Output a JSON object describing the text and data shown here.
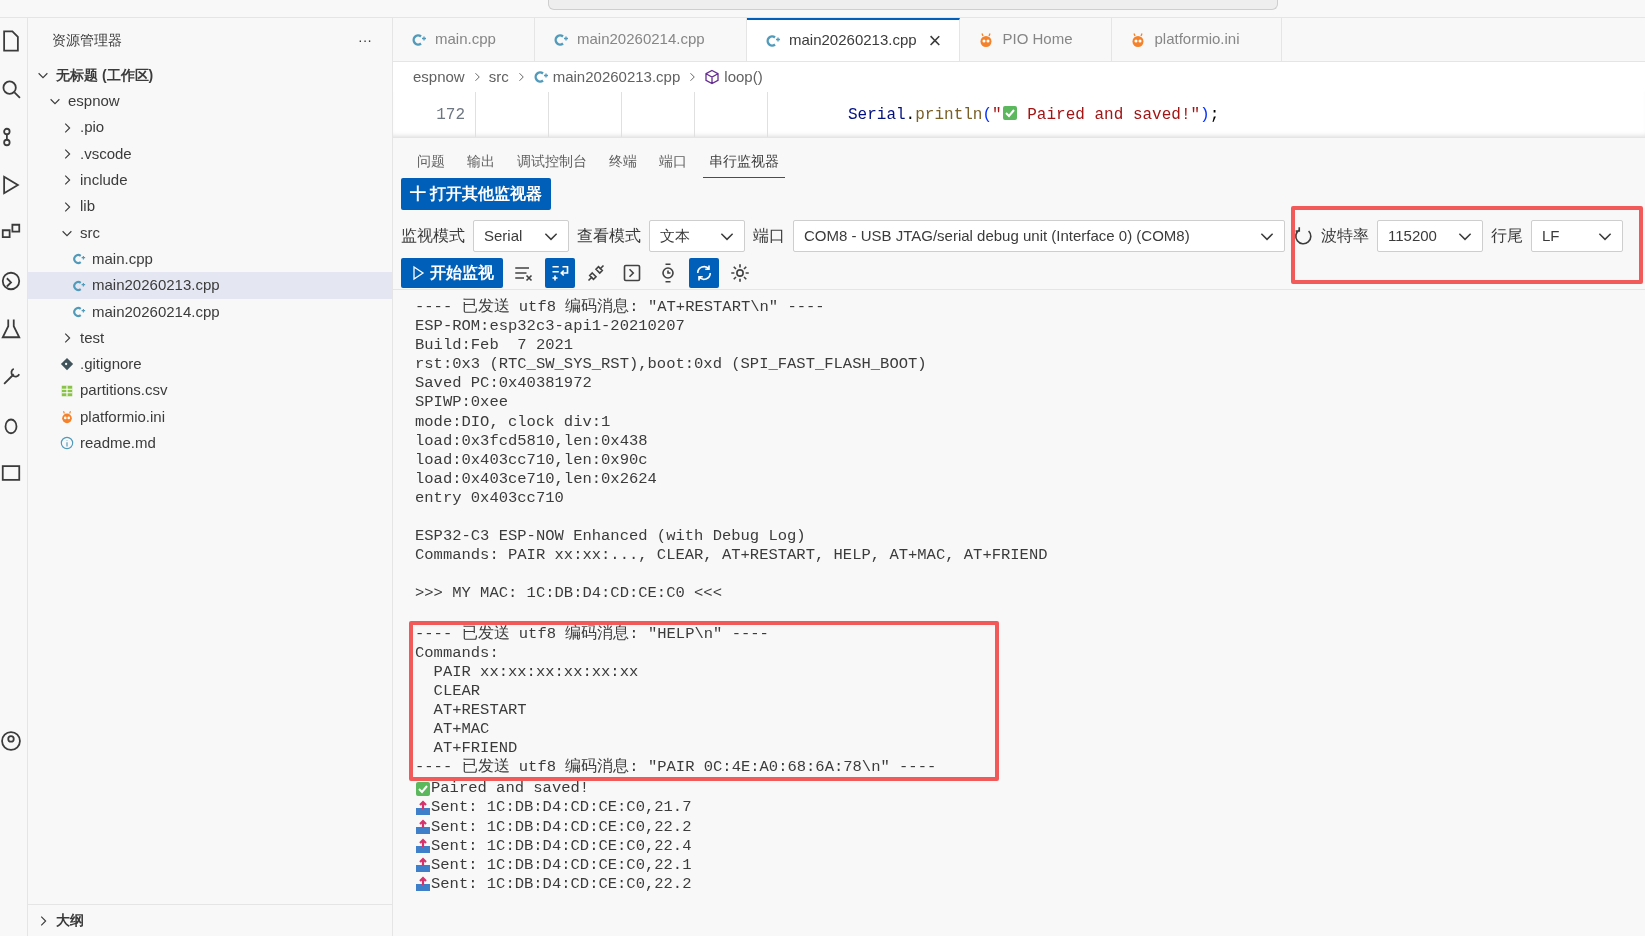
{
  "sidebar": {
    "title": "资源管理器",
    "more": "···",
    "tree": [
      {
        "label": "无标题 (工作区)",
        "kind": "workspace",
        "expanded": true,
        "selected": false,
        "children": [
          {
            "label": "espnow",
            "kind": "folder",
            "expanded": true,
            "selected": false,
            "children": [
              {
                "label": ".pio",
                "kind": "folder",
                "expanded": false,
                "selected": false
              },
              {
                "label": ".vscode",
                "kind": "folder",
                "expanded": false,
                "selected": false
              },
              {
                "label": "include",
                "kind": "folder",
                "expanded": false,
                "selected": false
              },
              {
                "label": "lib",
                "kind": "folder",
                "expanded": false,
                "selected": false
              },
              {
                "label": "src",
                "kind": "folder",
                "expanded": true,
                "selected": false,
                "children": [
                  {
                    "label": "main.cpp",
                    "kind": "cpp",
                    "selected": false
                  },
                  {
                    "label": "main20260213.cpp",
                    "kind": "cpp",
                    "selected": true
                  },
                  {
                    "label": "main20260214.cpp",
                    "kind": "cpp",
                    "selected": false
                  }
                ]
              },
              {
                "label": "test",
                "kind": "folder",
                "expanded": false,
                "selected": false
              },
              {
                "label": ".gitignore",
                "kind": "git",
                "selected": false
              },
              {
                "label": "partitions.csv",
                "kind": "csv",
                "selected": false
              },
              {
                "label": "platformio.ini",
                "kind": "pio",
                "selected": false
              },
              {
                "label": "readme.md",
                "kind": "info",
                "selected": false
              }
            ]
          }
        ]
      }
    ],
    "outline": {
      "label": "大纲",
      "expanded": false
    }
  },
  "tabs": [
    {
      "label": "main.cpp",
      "kind": "cpp",
      "selected": false
    },
    {
      "label": "main20260214.cpp",
      "kind": "cpp",
      "selected": false
    },
    {
      "label": "main20260213.cpp",
      "kind": "cpp",
      "selected": true,
      "close": "×"
    },
    {
      "label": "PIO Home",
      "kind": "pio",
      "selected": false
    },
    {
      "label": "platformio.ini",
      "kind": "pio",
      "selected": false
    }
  ],
  "breadcrumb": [
    {
      "label": "espnow",
      "kind": "plain"
    },
    {
      "label": "src",
      "kind": "plain"
    },
    {
      "label": "main20260213.cpp",
      "kind": "cpp"
    },
    {
      "label": "loop()",
      "kind": "method"
    }
  ],
  "code": {
    "line_number": "172",
    "tokens": [
      {
        "text": "Serial",
        "kind": "ident"
      },
      {
        "text": ".",
        "kind": "punct"
      },
      {
        "text": "println",
        "kind": "func"
      },
      {
        "text": "(",
        "kind": "paren"
      },
      {
        "text": "\"",
        "kind": "string"
      },
      {
        "kind": "check"
      },
      {
        "text": " Paired and saved!\"",
        "kind": "string"
      },
      {
        "text": ")",
        "kind": "paren"
      },
      {
        "text": ";",
        "kind": "punct"
      }
    ]
  },
  "panel_tabs": [
    {
      "label": "问题",
      "selected": false
    },
    {
      "label": "输出",
      "selected": false
    },
    {
      "label": "调试控制台",
      "selected": false
    },
    {
      "label": "终端",
      "selected": false
    },
    {
      "label": "端口",
      "selected": false
    },
    {
      "label": "串行监视器",
      "selected": true
    }
  ],
  "open_monitor_button": "十 打开其他监视器",
  "settings": [
    {
      "label": "监视模式",
      "value": "Serial",
      "kind": "select"
    },
    {
      "label": "查看模式",
      "value": "文本",
      "kind": "select"
    },
    {
      "label": "端口",
      "value": "COM8 - USB JTAG/serial debug unit (Interface 0) (COM8)",
      "kind": "port"
    }
  ],
  "highlighted_settings": {
    "highlighted": true,
    "items": [
      {
        "label": "波特率",
        "value": "115200"
      },
      {
        "label": "行尾",
        "value": "LF"
      }
    ]
  },
  "start_button": "开始监视",
  "tools": [
    {
      "kind": "clear",
      "selected": false
    },
    {
      "kind": "wrap",
      "selected": true
    },
    {
      "kind": "connect",
      "selected": false
    },
    {
      "kind": "terminal",
      "selected": false
    },
    {
      "kind": "timestamp",
      "selected": false
    },
    {
      "kind": "autoscroll",
      "selected": true
    },
    {
      "kind": "settings",
      "selected": false
    }
  ],
  "log_top": [
    {
      "kind": "plain",
      "text": "---- 已发送 utf8 编码消息: \"AT+RESTART\\n\" ----"
    },
    {
      "kind": "plain",
      "text": "ESP-ROM:esp32c3-api1-20210207"
    },
    {
      "kind": "plain",
      "text": "Build:Feb  7 2021"
    },
    {
      "kind": "plain",
      "text": "rst:0x3 (RTC_SW_SYS_RST),boot:0xd (SPI_FAST_FLASH_BOOT)"
    },
    {
      "kind": "plain",
      "text": "Saved PC:0x40381972"
    },
    {
      "kind": "plain",
      "text": "SPIWP:0xee"
    },
    {
      "kind": "plain",
      "text": "mode:DIO, clock div:1"
    },
    {
      "kind": "plain",
      "text": "load:0x3fcd5810,len:0x438"
    },
    {
      "kind": "plain",
      "text": "load:0x403cc710,len:0x90c"
    },
    {
      "kind": "plain",
      "text": "load:0x403ce710,len:0x2624"
    },
    {
      "kind": "plain",
      "text": "entry 0x403cc710"
    },
    {
      "kind": "blank"
    },
    {
      "kind": "plain",
      "text": "ESP32-C3 ESP-NOW Enhanced (with Debug Log)"
    },
    {
      "kind": "plain",
      "text": "Commands: PAIR xx:xx:..., CLEAR, AT+RESTART, HELP, AT+MAC, AT+FRIEND"
    },
    {
      "kind": "blank"
    },
    {
      "kind": "plain",
      "text": ">>> MY MAC: 1C:DB:D4:CD:CE:C0 <<<"
    },
    {
      "kind": "blank"
    }
  ],
  "log_highlight": {
    "highlighted": true,
    "lines": [
      {
        "kind": "plain",
        "text": "---- 已发送 utf8 编码消息: \"HELP\\n\" ----"
      },
      {
        "kind": "plain",
        "text": "Commands:"
      },
      {
        "kind": "plain",
        "text": "  PAIR xx:xx:xx:xx:xx:xx"
      },
      {
        "kind": "plain",
        "text": "  CLEAR"
      },
      {
        "kind": "plain",
        "text": "  AT+RESTART"
      },
      {
        "kind": "plain",
        "text": "  AT+MAC"
      },
      {
        "kind": "plain",
        "text": "  AT+FRIEND"
      },
      {
        "kind": "plain",
        "text": "---- 已发送 utf8 编码消息: \"PAIR 0C:4E:A0:68:6A:78\\n\" ----"
      }
    ]
  },
  "log_bottom": [
    {
      "kind": "check",
      "text": "Paired and saved!"
    },
    {
      "kind": "sent",
      "text": "Sent: 1C:DB:D4:CD:CE:C0,21.7"
    },
    {
      "kind": "sent",
      "text": "Sent: 1C:DB:D4:CD:CE:C0,22.2"
    },
    {
      "kind": "sent",
      "text": "Sent: 1C:DB:D4:CD:CE:C0,22.4"
    },
    {
      "kind": "sent",
      "text": "Sent: 1C:DB:D4:CD:CE:C0,22.1"
    },
    {
      "kind": "sent",
      "text": "Sent: 1C:DB:D4:CD:CE:C0,22.2"
    }
  ]
}
